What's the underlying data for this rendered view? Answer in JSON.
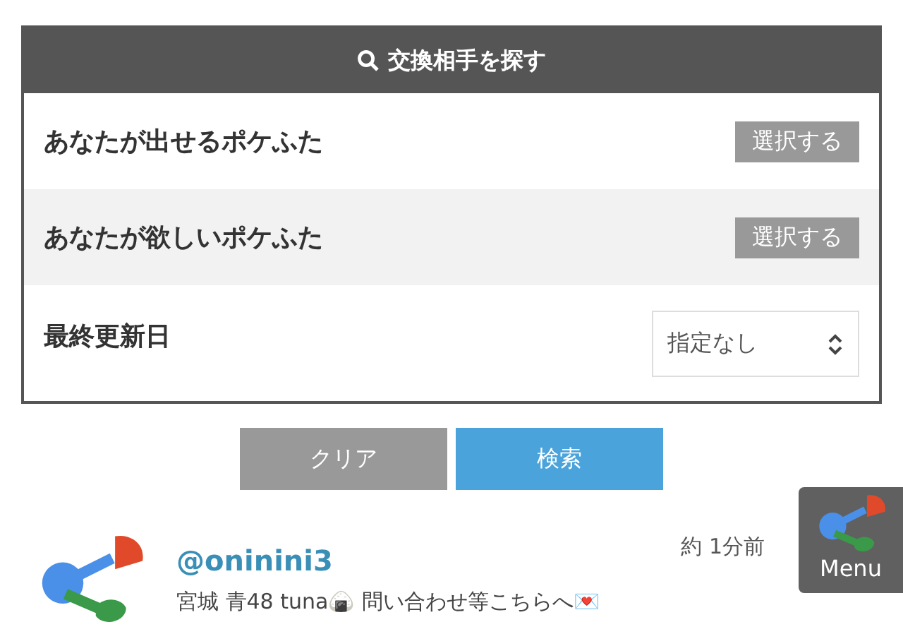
{
  "search_panel": {
    "title": "交換相手を探す",
    "rows": [
      {
        "kind": "button",
        "label": "あなたが出せるポケふた",
        "button": "選択する"
      },
      {
        "kind": "button",
        "label": "あなたが欲しいポケふた",
        "button": "選択する"
      },
      {
        "kind": "select",
        "label": "最終更新日",
        "value": "指定なし"
      }
    ]
  },
  "actions": {
    "clear": "クリア",
    "search": "検索"
  },
  "user": {
    "handle": "@oninini3",
    "bio": "宮城 青48 tuna🍙 問い合わせ等こちらへ💌",
    "time": "約 1分前"
  },
  "menu": {
    "label": "Menu"
  }
}
